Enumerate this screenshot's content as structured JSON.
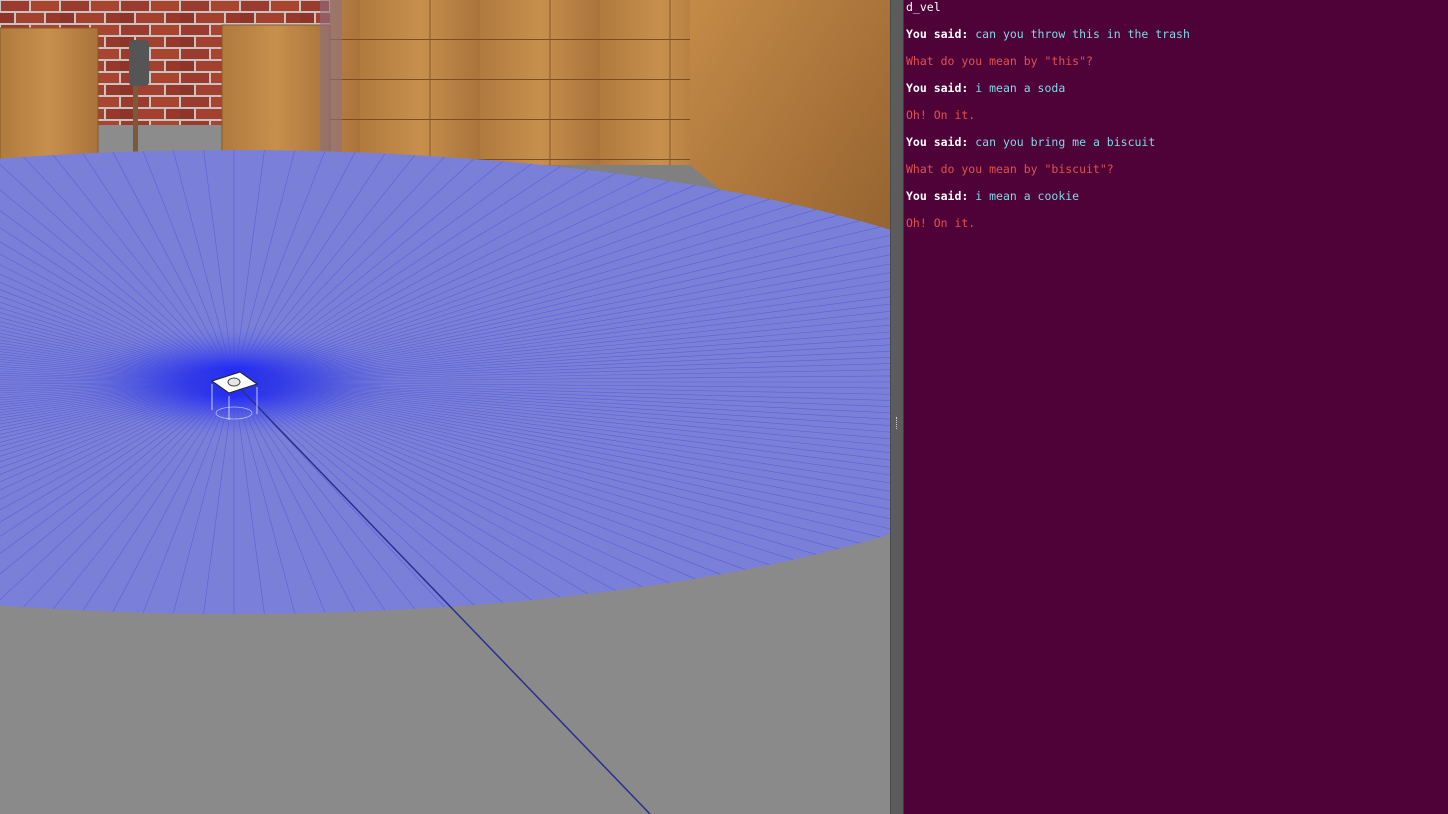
{
  "simulation": {
    "name": "3D simulation viewport"
  },
  "terminal": {
    "first_line": "d_vel",
    "lines": [
      {
        "type": "user",
        "prefix": "You said:",
        "text": "can you throw this in the trash"
      },
      {
        "type": "reply",
        "text": "What do you mean by \"this\"?"
      },
      {
        "type": "user",
        "prefix": "You said:",
        "text": "i mean a soda"
      },
      {
        "type": "reply",
        "text": "Oh! On it."
      },
      {
        "type": "user",
        "prefix": "You said:",
        "text": "can you bring me a biscuit"
      },
      {
        "type": "reply",
        "text": "What do you mean by \"biscuit\"?"
      },
      {
        "type": "user",
        "prefix": "You said:",
        "text": "i mean a cookie"
      },
      {
        "type": "reply",
        "text": "Oh! On it."
      }
    ]
  },
  "colors": {
    "terminal_bg": "#4f0237",
    "user_text": "#7fd8e6",
    "reply_text": "#e0524f",
    "laser_fill": "#7a80d8",
    "laser_core": "#1a22ff"
  }
}
